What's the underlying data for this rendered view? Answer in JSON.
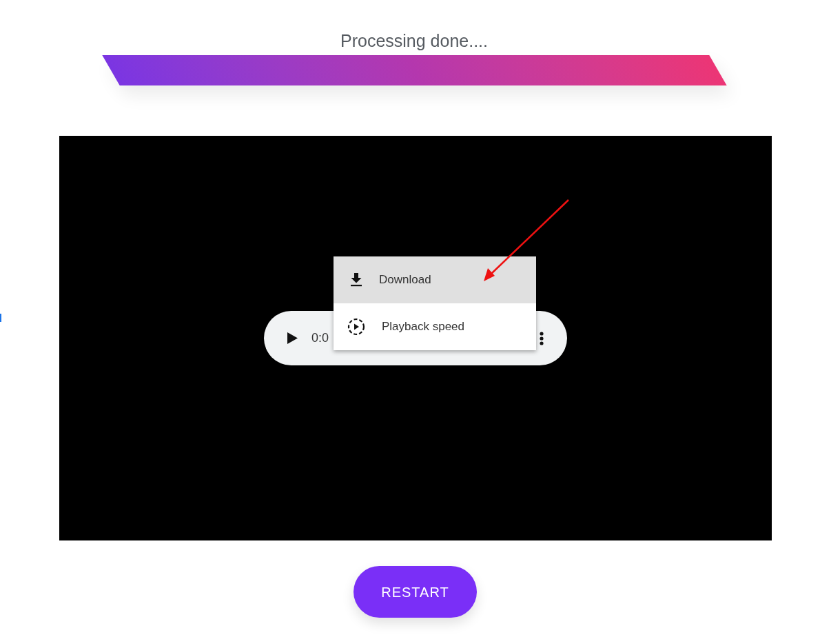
{
  "status": {
    "title": "Processing done...."
  },
  "player": {
    "time": "0:0",
    "menu": [
      {
        "label": "Download",
        "kind": "download",
        "selected": true
      },
      {
        "label": "Playback speed",
        "kind": "speed",
        "selected": false
      }
    ]
  },
  "restart_button": {
    "label": "RESTART"
  }
}
